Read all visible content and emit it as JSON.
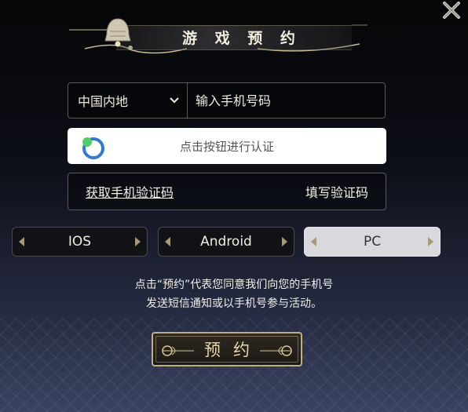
{
  "header": {
    "title": "游 戏 预 约"
  },
  "phone": {
    "region": "中国内地",
    "placeholder": "输入手机号码"
  },
  "verify": {
    "label": "点击按钮进行认证"
  },
  "code": {
    "get_label": "获取手机验证码",
    "fill_label": "填写验证码"
  },
  "platforms": [
    {
      "label": "IOS",
      "selected": false
    },
    {
      "label": "Android",
      "selected": false
    },
    {
      "label": "PC",
      "selected": true
    }
  ],
  "notice": {
    "line1": "点击“预约”代表您同意我们向您的手机号",
    "line2": "发送短信通知或以手机号参与活动。"
  },
  "reserve_button": {
    "label": "预约"
  },
  "icons": {
    "close": "close-icon",
    "bell": "bell-icon",
    "region_dropdown": "chevron-down-icon",
    "verify": "captcha-ring-icon"
  },
  "colors": {
    "gold": "#bfae82",
    "selected_platform": "#d9d9dd"
  }
}
